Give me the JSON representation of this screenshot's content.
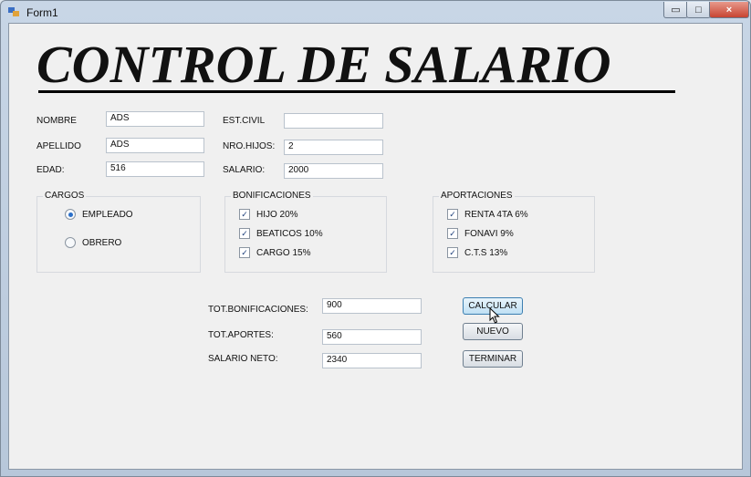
{
  "window": {
    "title": "Form1",
    "close_icon": "×",
    "min_icon": "▭",
    "max_icon": "□"
  },
  "heading": "CONTROL DE SALARIO",
  "fields": {
    "nombre": {
      "label": "NOMBRE",
      "value": "ADS"
    },
    "apellido": {
      "label": "APELLIDO",
      "value": "ADS"
    },
    "edad": {
      "label": "EDAD:",
      "value": "516"
    },
    "estcivil": {
      "label": "EST.CIVIL",
      "value": ""
    },
    "nrohijos": {
      "label": "NRO.HIJOS:",
      "value": "2"
    },
    "salario": {
      "label": "SALARIO:",
      "value": "2000"
    }
  },
  "cargos": {
    "title": "CARGOS",
    "options": [
      {
        "label": "EMPLEADO",
        "selected": true
      },
      {
        "label": "OBRERO",
        "selected": false
      }
    ]
  },
  "bonificaciones": {
    "title": "BONIFICACIONES",
    "options": [
      {
        "label": "HIJO 20%",
        "checked": true
      },
      {
        "label": "BEATICOS 10%",
        "checked": true
      },
      {
        "label": "CARGO 15%",
        "checked": true
      }
    ]
  },
  "aportaciones": {
    "title": "APORTACIONES",
    "options": [
      {
        "label": "RENTA 4TA 6%",
        "checked": true
      },
      {
        "label": "FONAVI 9%",
        "checked": true
      },
      {
        "label": "C.T.S 13%",
        "checked": true
      }
    ]
  },
  "totals": {
    "bonificaciones": {
      "label": "TOT.BONIFICACIONES:",
      "value": "900"
    },
    "aportes": {
      "label": "TOT.APORTES:",
      "value": "560"
    },
    "neto": {
      "label": "SALARIO NETO:",
      "value": "2340"
    }
  },
  "buttons": {
    "calcular": "CALCULAR",
    "nuevo": "NUEVO",
    "terminar": "TERMINAR"
  },
  "checkmark": "✓"
}
